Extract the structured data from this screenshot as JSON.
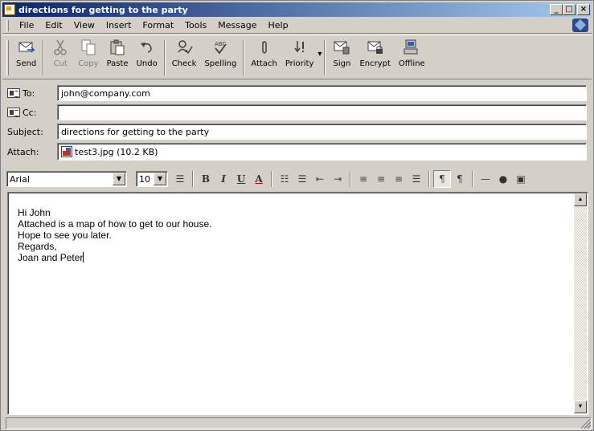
{
  "window": {
    "title": "directions for getting to the party"
  },
  "menu": [
    "File",
    "Edit",
    "View",
    "Insert",
    "Format",
    "Tools",
    "Message",
    "Help"
  ],
  "toolbar": {
    "send": "Send",
    "cut": "Cut",
    "copy": "Copy",
    "paste": "Paste",
    "undo": "Undo",
    "check": "Check",
    "spelling": "Spelling",
    "attach": "Attach",
    "priority": "Priority",
    "sign": "Sign",
    "encrypt": "Encrypt",
    "offline": "Offline"
  },
  "header": {
    "to_label": "To:",
    "to_value": "john@company.com",
    "cc_label": "Cc:",
    "cc_value": "",
    "subject_label": "Subject:",
    "subject_value": "directions for getting to the party",
    "attach_label": "Attach:",
    "attach_value": "test3.jpg (10.2 KB)"
  },
  "format": {
    "font": "Arial",
    "size": "10"
  },
  "body": {
    "lines": [
      "Hi John",
      "Attached is a map of how to get to our house.",
      "Hope to see you later.",
      "Regards,",
      "Joan and Peter"
    ]
  }
}
